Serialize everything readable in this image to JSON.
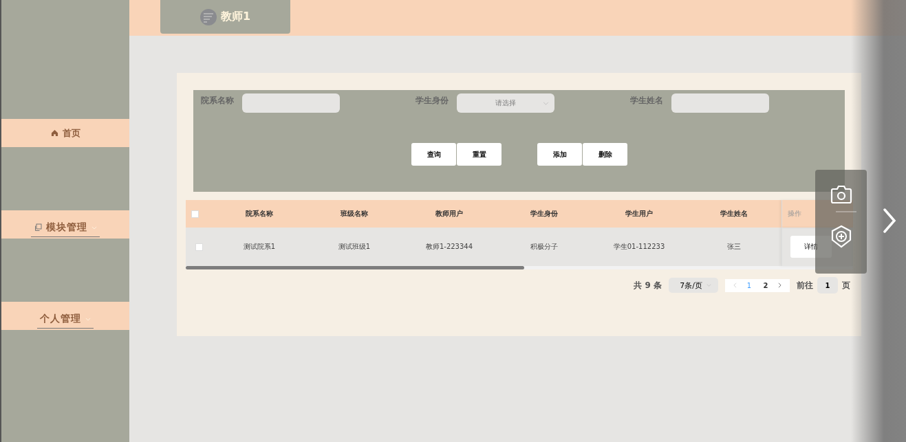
{
  "header": {
    "title": "教师1"
  },
  "sidebar": {
    "items": [
      {
        "label": "首页",
        "kind": "link"
      },
      {
        "label": "模块管理",
        "kind": "group"
      },
      {
        "label": "个人管理",
        "kind": "menu"
      }
    ]
  },
  "search": {
    "fields": [
      {
        "label": "院系名称",
        "kind": "input"
      },
      {
        "label": "学生身份",
        "kind": "select",
        "placeholder": "请选择"
      },
      {
        "label": "学生姓名",
        "kind": "input"
      }
    ],
    "button_groups": [
      [
        "查询",
        "重置"
      ],
      [
        "添加",
        "删除"
      ]
    ]
  },
  "table": {
    "header_checked": false,
    "columns": [
      "院系名称",
      "班级名称",
      "教师用户",
      "学生身份",
      "学生用户",
      "学生姓名"
    ],
    "action_column": "操作",
    "rows": [
      {
        "checked": false,
        "cells": [
          "测试院系1",
          "测试班级1",
          "教师1-223344",
          "积极分子",
          "学生01-112233",
          "张三"
        ],
        "action": "详情"
      }
    ]
  },
  "pagination": {
    "total": "共 9 条",
    "page_size": "7条/页",
    "pages": [
      {
        "label": "1",
        "selected": true
      },
      {
        "label": "2",
        "selected": false
      }
    ],
    "goto_label": "前往",
    "goto_value": "1",
    "goto_suffix": "页"
  }
}
